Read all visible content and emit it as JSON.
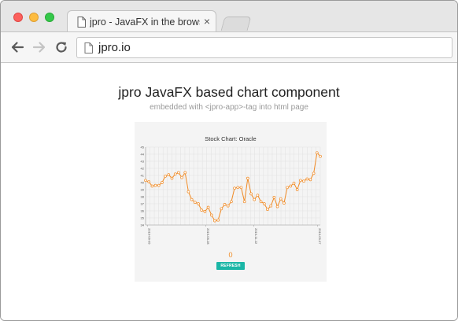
{
  "browser": {
    "tab_title": "jpro - JavaFX in the browser",
    "tab_close": "×",
    "url": "jpro.io",
    "icons": {
      "back": "back-arrow-icon",
      "forward": "forward-arrow-icon",
      "reload": "reload-icon",
      "page": "document-icon",
      "close": "close-icon"
    }
  },
  "page": {
    "headline": "jpro JavaFX based chart component",
    "subline": "embedded with <jpro-app>-tag into html page",
    "counter": "0",
    "refresh_label": "REFRESH"
  },
  "colors": {
    "series": "#f08a24",
    "button": "#1bb6a6"
  },
  "chart_data": {
    "type": "line",
    "title": "Stock Chart: Oracle",
    "xlabel": "",
    "ylabel": "",
    "ylim": [
      34,
      45
    ],
    "y_ticks": [
      "34",
      "35",
      "36",
      "37",
      "38",
      "39",
      "40",
      "41",
      "42",
      "43",
      "44",
      "45"
    ],
    "x_tick_labels": [
      "2016-06-05",
      "2016-08-28",
      "2016-11-22",
      "2016-05-07"
    ],
    "grid": true,
    "series": [
      {
        "values": [
          40.3,
          40.1,
          39.5,
          39.6,
          39.6,
          40.0,
          40.9,
          41.1,
          40.6,
          41.2,
          41.4,
          40.7,
          41.4,
          38.7,
          37.6,
          37.2,
          37.0,
          36.1,
          35.9,
          36.5,
          35.4,
          34.6,
          34.7,
          36.3,
          36.9,
          36.7,
          37.3,
          39.2,
          39.3,
          39.3,
          37.3,
          40.6,
          38.4,
          37.6,
          38.2,
          37.3,
          37.0,
          36.2,
          36.7,
          37.9,
          36.6,
          37.7,
          37.1,
          39.3,
          39.5,
          39.9,
          39.0,
          40.3,
          40.2,
          40.5,
          40.4,
          41.3,
          44.2,
          43.7
        ]
      }
    ]
  }
}
